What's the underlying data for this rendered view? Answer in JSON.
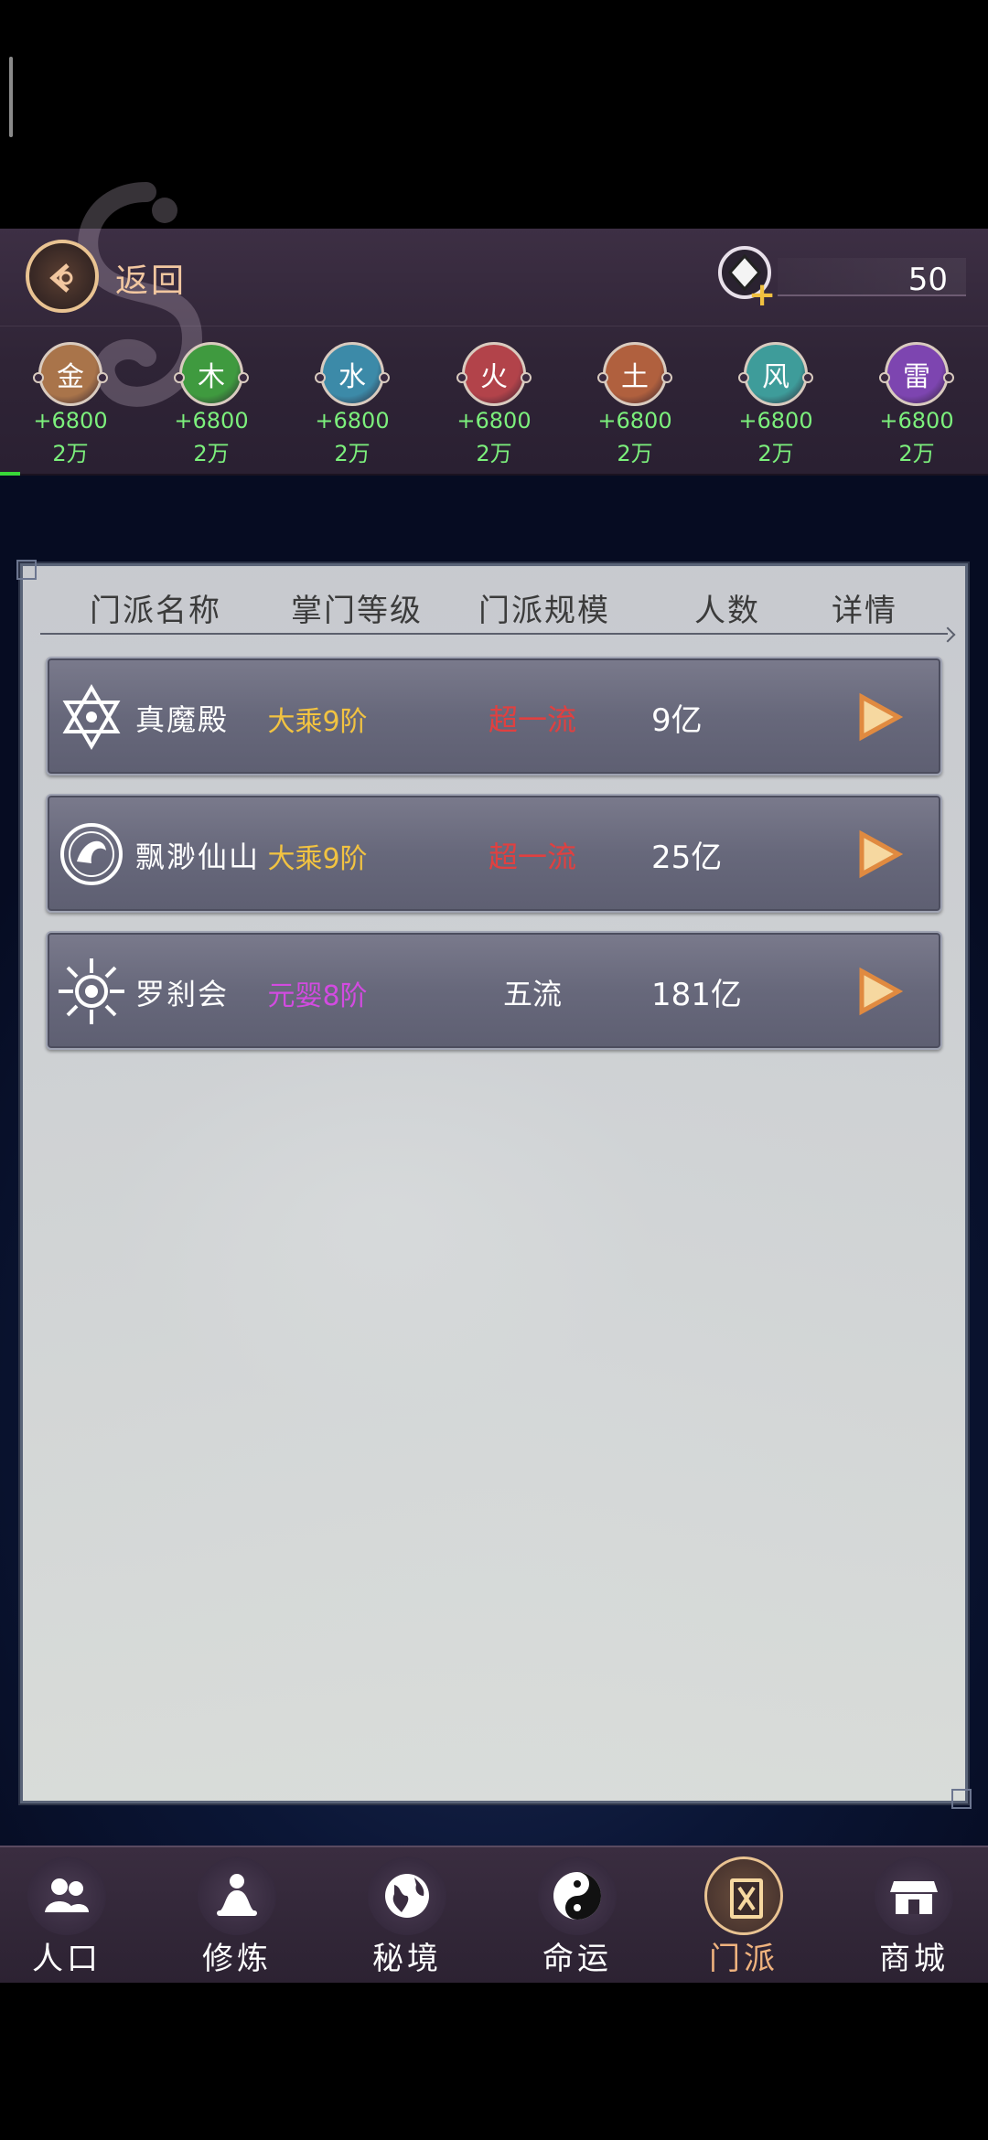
{
  "header": {
    "back_label": "返回",
    "currency_value": "50",
    "currency_icon": "spirit-stone-icon"
  },
  "elements": [
    {
      "symbol": "金",
      "gain": "+6800",
      "total": "2万",
      "color": "#a9744a"
    },
    {
      "symbol": "木",
      "gain": "+6800",
      "total": "2万",
      "color": "#3f9a3f"
    },
    {
      "symbol": "水",
      "gain": "+6800",
      "total": "2万",
      "color": "#3c8aa8"
    },
    {
      "symbol": "火",
      "gain": "+6800",
      "total": "2万",
      "color": "#b2434a"
    },
    {
      "symbol": "土",
      "gain": "+6800",
      "total": "2万",
      "color": "#b0603e"
    },
    {
      "symbol": "风",
      "gain": "+6800",
      "total": "2万",
      "color": "#3e9c9a"
    },
    {
      "symbol": "雷",
      "gain": "+6800",
      "total": "2万",
      "color": "#7d45b0"
    }
  ],
  "table": {
    "headers": [
      "门派名称",
      "掌门等级",
      "门派规模",
      "人数",
      "详情"
    ],
    "rows": [
      {
        "name": "真魔殿",
        "level": "大乘9阶",
        "level_color": "#f2c341",
        "scale": "超一流",
        "scale_color": "#e04040",
        "count": "9亿",
        "emblem": "hexagram-emblem-icon"
      },
      {
        "name": "飘渺仙山",
        "level": "大乘9阶",
        "level_color": "#f2c341",
        "scale": "超一流",
        "scale_color": "#e04040",
        "count": "25亿",
        "emblem": "crane-emblem-icon"
      },
      {
        "name": "罗刹会",
        "level": "元婴8阶",
        "level_color": "#d24be0",
        "scale": "五流",
        "scale_color": "#ffffff",
        "count": "181亿",
        "emblem": "sun-emblem-icon"
      }
    ]
  },
  "nav": [
    {
      "label": "人口",
      "icon": "people-icon"
    },
    {
      "label": "修炼",
      "icon": "meditation-icon"
    },
    {
      "label": "秘境",
      "icon": "globe-icon"
    },
    {
      "label": "命运",
      "icon": "yin-yang-icon"
    },
    {
      "label": "门派",
      "icon": "sect-book-icon",
      "active": true
    },
    {
      "label": "商城",
      "icon": "shop-icon"
    }
  ],
  "colors": {
    "accent": "#f0b37e",
    "gain": "#7cf07c"
  }
}
